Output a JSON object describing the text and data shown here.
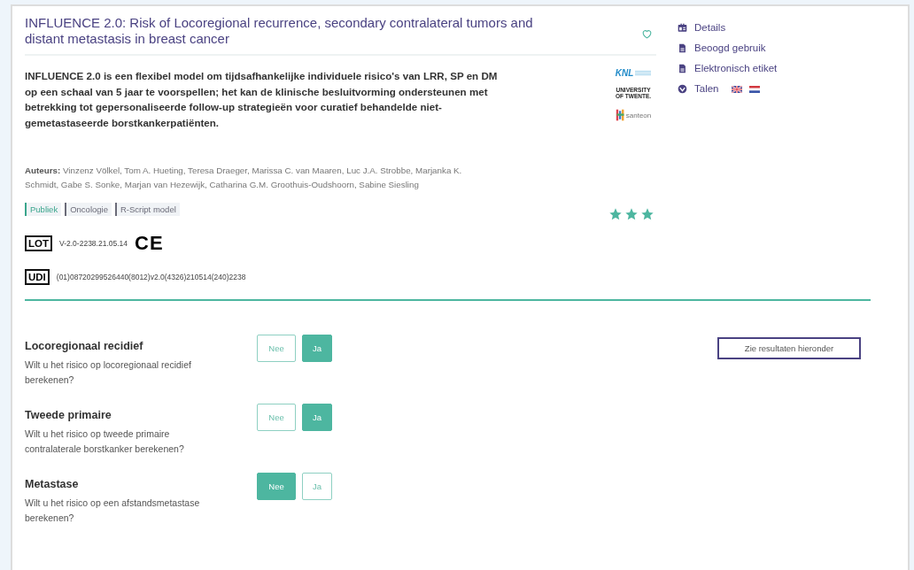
{
  "title": "INFLUENCE 2.0: Risk of Locoregional recurrence, secondary contralateral tumors and distant metastasis in breast cancer",
  "favorite": {
    "selected": false
  },
  "description": "INFLUENCE 2.0 is een flexibel model om tijdsafhankelijke individuele risico's van LRR, SP en DM op een schaal van 5 jaar te voorspellen; het kan de klinische besluitvorming ondersteunen met betrekking tot gepersonaliseerde follow-up strategieën voor curatief behandelde niet-gemetastaseerde borstkankerpatiënten.",
  "logos": [
    {
      "kind": "knl",
      "text": "KNL"
    },
    {
      "kind": "twente",
      "text": "UNIVERSITY OF TWENTE."
    },
    {
      "kind": "santeon",
      "text": "santeon"
    }
  ],
  "authors": {
    "label": "Auteurs:",
    "names": "Vinzenz Völkel, Tom A. Hueting, Teresa Draeger, Marissa C. van Maaren, Luc J.A. Strobbe, Marjanka K. Schmidt, Gabe S. Sonke, Marjan van Hezewijk, Catharina G.M. Groothuis-Oudshoorn, Sabine Siesling"
  },
  "tags": [
    {
      "label": "Publiek",
      "color": "#3aa58c"
    },
    {
      "label": "Oncologie",
      "color": "#6b6b78"
    },
    {
      "label": "R-Script model",
      "color": "#6b6b78"
    }
  ],
  "stars": 3,
  "lot": {
    "symbol": "LOT",
    "value": "V-2.0-2238.21.05.14",
    "ce": "CE"
  },
  "udi": {
    "symbol": "UDI",
    "value": "(01)08720299526440(8012)v2.0(4326)210514(240)2238"
  },
  "sidebar": [
    {
      "kind": "details",
      "label": "Details"
    },
    {
      "kind": "doc",
      "label": "Beoogd gebruik"
    },
    {
      "kind": "doc",
      "label": "Elektronisch etiket"
    },
    {
      "kind": "languages",
      "label": "Talen",
      "flags": [
        {
          "kind": "uk"
        },
        {
          "kind": "nl"
        }
      ]
    }
  ],
  "questions": [
    {
      "title": "Locoregionaal recidief",
      "text": "Wilt u het risico op locoregionaal recidief berekenen?",
      "options": [
        {
          "label": "Nee",
          "selected": false
        },
        {
          "label": "Ja",
          "selected": true
        }
      ]
    },
    {
      "title": "Tweede primaire",
      "text": "Wilt u het risico op tweede primaire contralaterale borstkanker berekenen?",
      "options": [
        {
          "label": "Nee",
          "selected": false
        },
        {
          "label": "Ja",
          "selected": true
        }
      ]
    },
    {
      "title": "Metastase",
      "text": "Wilt u het risico op een afstandsmetastase berekenen?",
      "options": [
        {
          "label": "Nee",
          "selected": true
        },
        {
          "label": "Ja",
          "selected": false
        }
      ]
    }
  ],
  "results_button": "Zie resultaten hieronder"
}
